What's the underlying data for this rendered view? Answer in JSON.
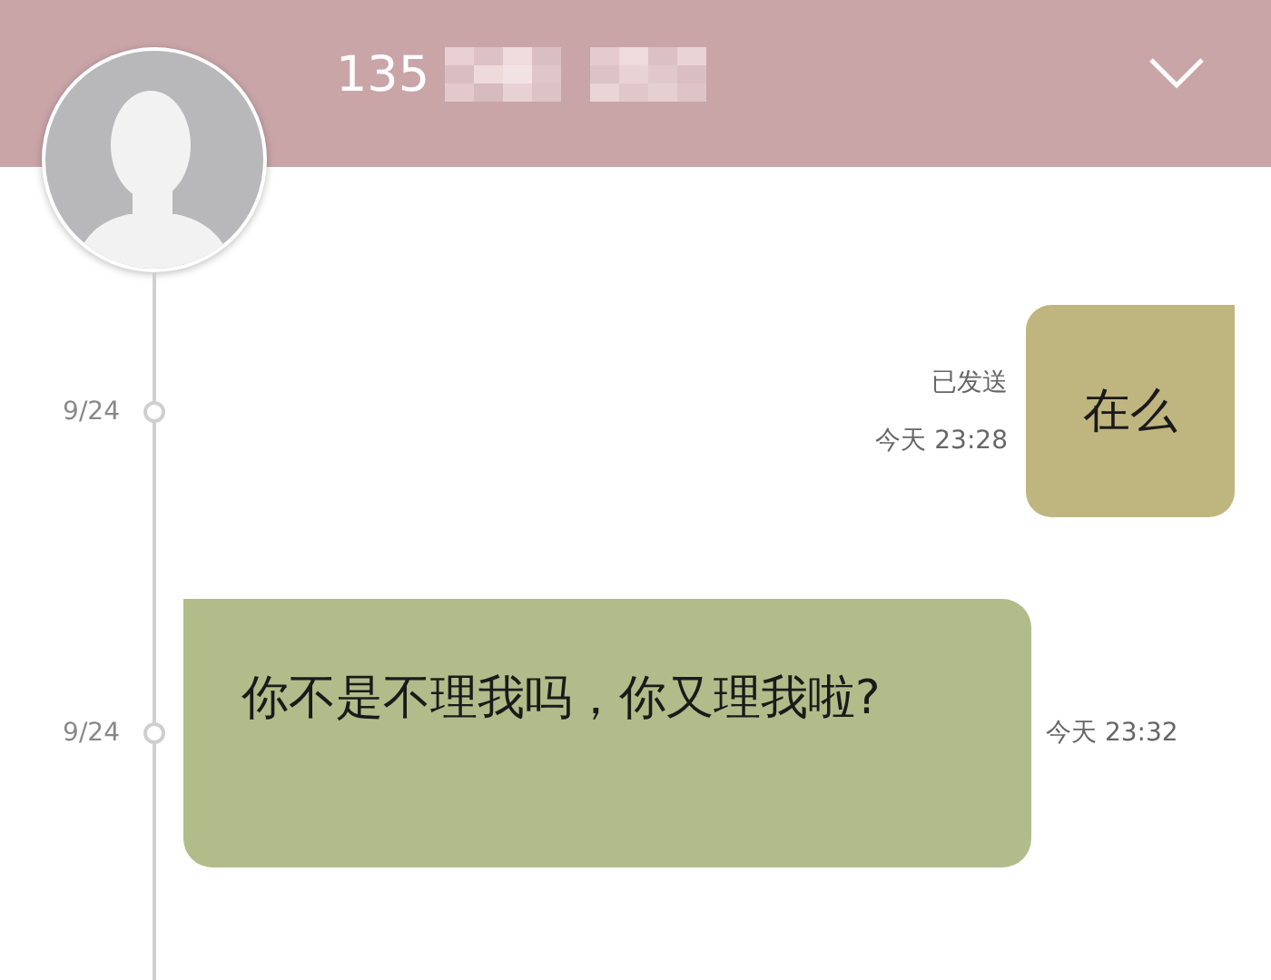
{
  "header": {
    "contact": "135"
  },
  "messages": [
    {
      "kind": "outgoing",
      "date": "9/24",
      "status": "已发送",
      "time": "今天 23:28",
      "text": "在么"
    },
    {
      "kind": "incoming",
      "date": "9/24",
      "time": "今天 23:32",
      "text": "你不是不理我吗，你又理我啦?"
    }
  ]
}
